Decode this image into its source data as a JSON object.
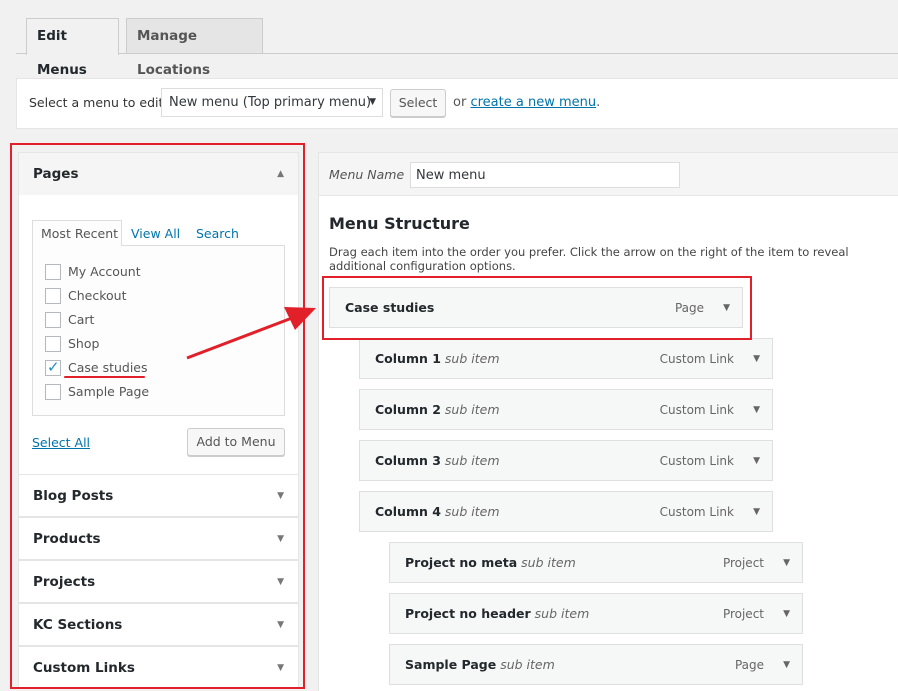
{
  "tabs": [
    {
      "label": "Edit Menus",
      "active": true
    },
    {
      "label": "Manage Locations",
      "active": false
    }
  ],
  "select_bar": {
    "label": "Select a menu to edit:",
    "selected": "New menu (Top primary menu)",
    "button": "Select",
    "or": "or",
    "link": "create a new menu",
    "period": "."
  },
  "left": {
    "pages": {
      "title": "Pages",
      "tabs": [
        "Most Recent",
        "View All",
        "Search"
      ],
      "items": [
        {
          "label": "My Account",
          "checked": false
        },
        {
          "label": "Checkout",
          "checked": false
        },
        {
          "label": "Cart",
          "checked": false
        },
        {
          "label": "Shop",
          "checked": false
        },
        {
          "label": "Case studies",
          "checked": true
        },
        {
          "label": "Sample Page",
          "checked": false
        }
      ],
      "select_all": "Select All",
      "add_button": "Add to Menu"
    },
    "sections": [
      "Blog Posts",
      "Products",
      "Projects",
      "KC Sections",
      "Custom Links"
    ]
  },
  "right": {
    "menu_name_label": "Menu Name",
    "menu_name_value": "New menu",
    "heading": "Menu Structure",
    "description": "Drag each item into the order you prefer. Click the arrow on the right of the item to reveal additional configuration options.",
    "items": [
      {
        "title": "Case studies",
        "sub": "",
        "type": "Page",
        "depth": 0
      },
      {
        "title": "Column 1",
        "sub": "sub item",
        "type": "Custom Link",
        "depth": 1
      },
      {
        "title": "Column 2",
        "sub": "sub item",
        "type": "Custom Link",
        "depth": 1
      },
      {
        "title": "Column 3",
        "sub": "sub item",
        "type": "Custom Link",
        "depth": 1
      },
      {
        "title": "Column 4",
        "sub": "sub item",
        "type": "Custom Link",
        "depth": 1
      },
      {
        "title": "Project no meta",
        "sub": "sub item",
        "type": "Project",
        "depth": 2
      },
      {
        "title": "Project no header",
        "sub": "sub item",
        "type": "Project",
        "depth": 2
      },
      {
        "title": "Sample Page",
        "sub": "sub item",
        "type": "Page",
        "depth": 2
      }
    ]
  },
  "colors": {
    "annotation": "#e2202a",
    "link": "#0073aa",
    "check": "#1e8cbe"
  }
}
